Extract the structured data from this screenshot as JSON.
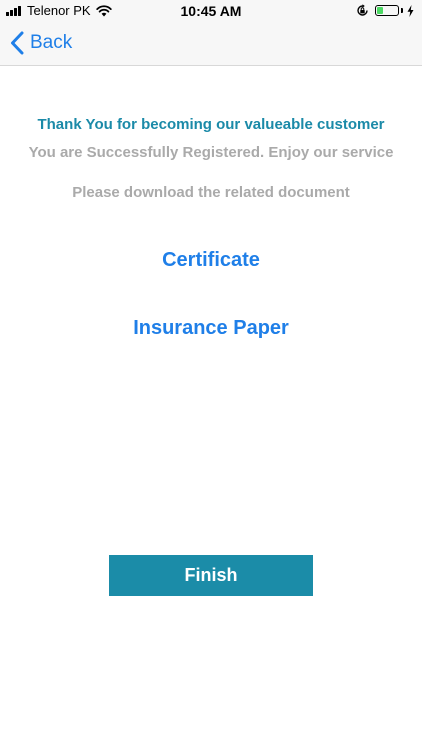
{
  "status_bar": {
    "carrier": "Telenor PK",
    "time": "10:45 AM",
    "battery_level": 0.3,
    "battery_color": "#4cd964"
  },
  "nav": {
    "back_label": "Back"
  },
  "main": {
    "thanks": "Thank You for becoming our valueable customer",
    "registered": "You are Successfully Registered. Enjoy our service",
    "download_prompt": "Please download the related document",
    "documents": [
      {
        "label": "Certificate"
      },
      {
        "label": "Insurance Paper"
      }
    ]
  },
  "finish_button": {
    "label": "Finish"
  },
  "colors": {
    "accent_teal": "#1b8ca8",
    "link_blue": "#1f7fe8",
    "muted_gray": "#aaaaaa"
  }
}
